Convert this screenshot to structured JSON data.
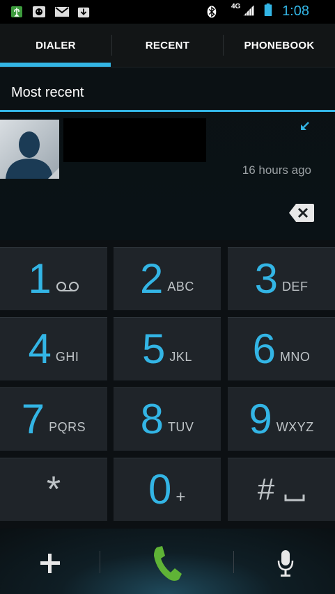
{
  "status_bar": {
    "time": "1:08",
    "network_type": "4G",
    "icons": [
      "usb-debug-icon",
      "android-icon",
      "gmail-icon",
      "download-icon",
      "bluetooth-icon",
      "signal-icon",
      "battery-icon"
    ]
  },
  "tabs": [
    {
      "label": "DIALER",
      "selected": true
    },
    {
      "label": "RECENT",
      "selected": false
    },
    {
      "label": "PHONEBOOK",
      "selected": false
    }
  ],
  "recent": {
    "section_title": "Most recent",
    "entry": {
      "time_ago": "16 hours ago",
      "call_type": "incoming-call-icon"
    }
  },
  "keypad": {
    "keys": [
      {
        "digit": "1",
        "letters": ""
      },
      {
        "digit": "2",
        "letters": "ABC"
      },
      {
        "digit": "3",
        "letters": "DEF"
      },
      {
        "digit": "4",
        "letters": "GHI"
      },
      {
        "digit": "5",
        "letters": "JKL"
      },
      {
        "digit": "6",
        "letters": "MNO"
      },
      {
        "digit": "7",
        "letters": "PQRS"
      },
      {
        "digit": "8",
        "letters": "TUV"
      },
      {
        "digit": "9",
        "letters": "WXYZ"
      },
      {
        "digit": "*",
        "letters": ""
      },
      {
        "digit": "0",
        "letters": "+"
      },
      {
        "digit": "#",
        "letters": ""
      }
    ]
  },
  "colors": {
    "accent": "#33b5e5",
    "call_green": "#5fb336",
    "key_bg": "#1f2429"
  }
}
